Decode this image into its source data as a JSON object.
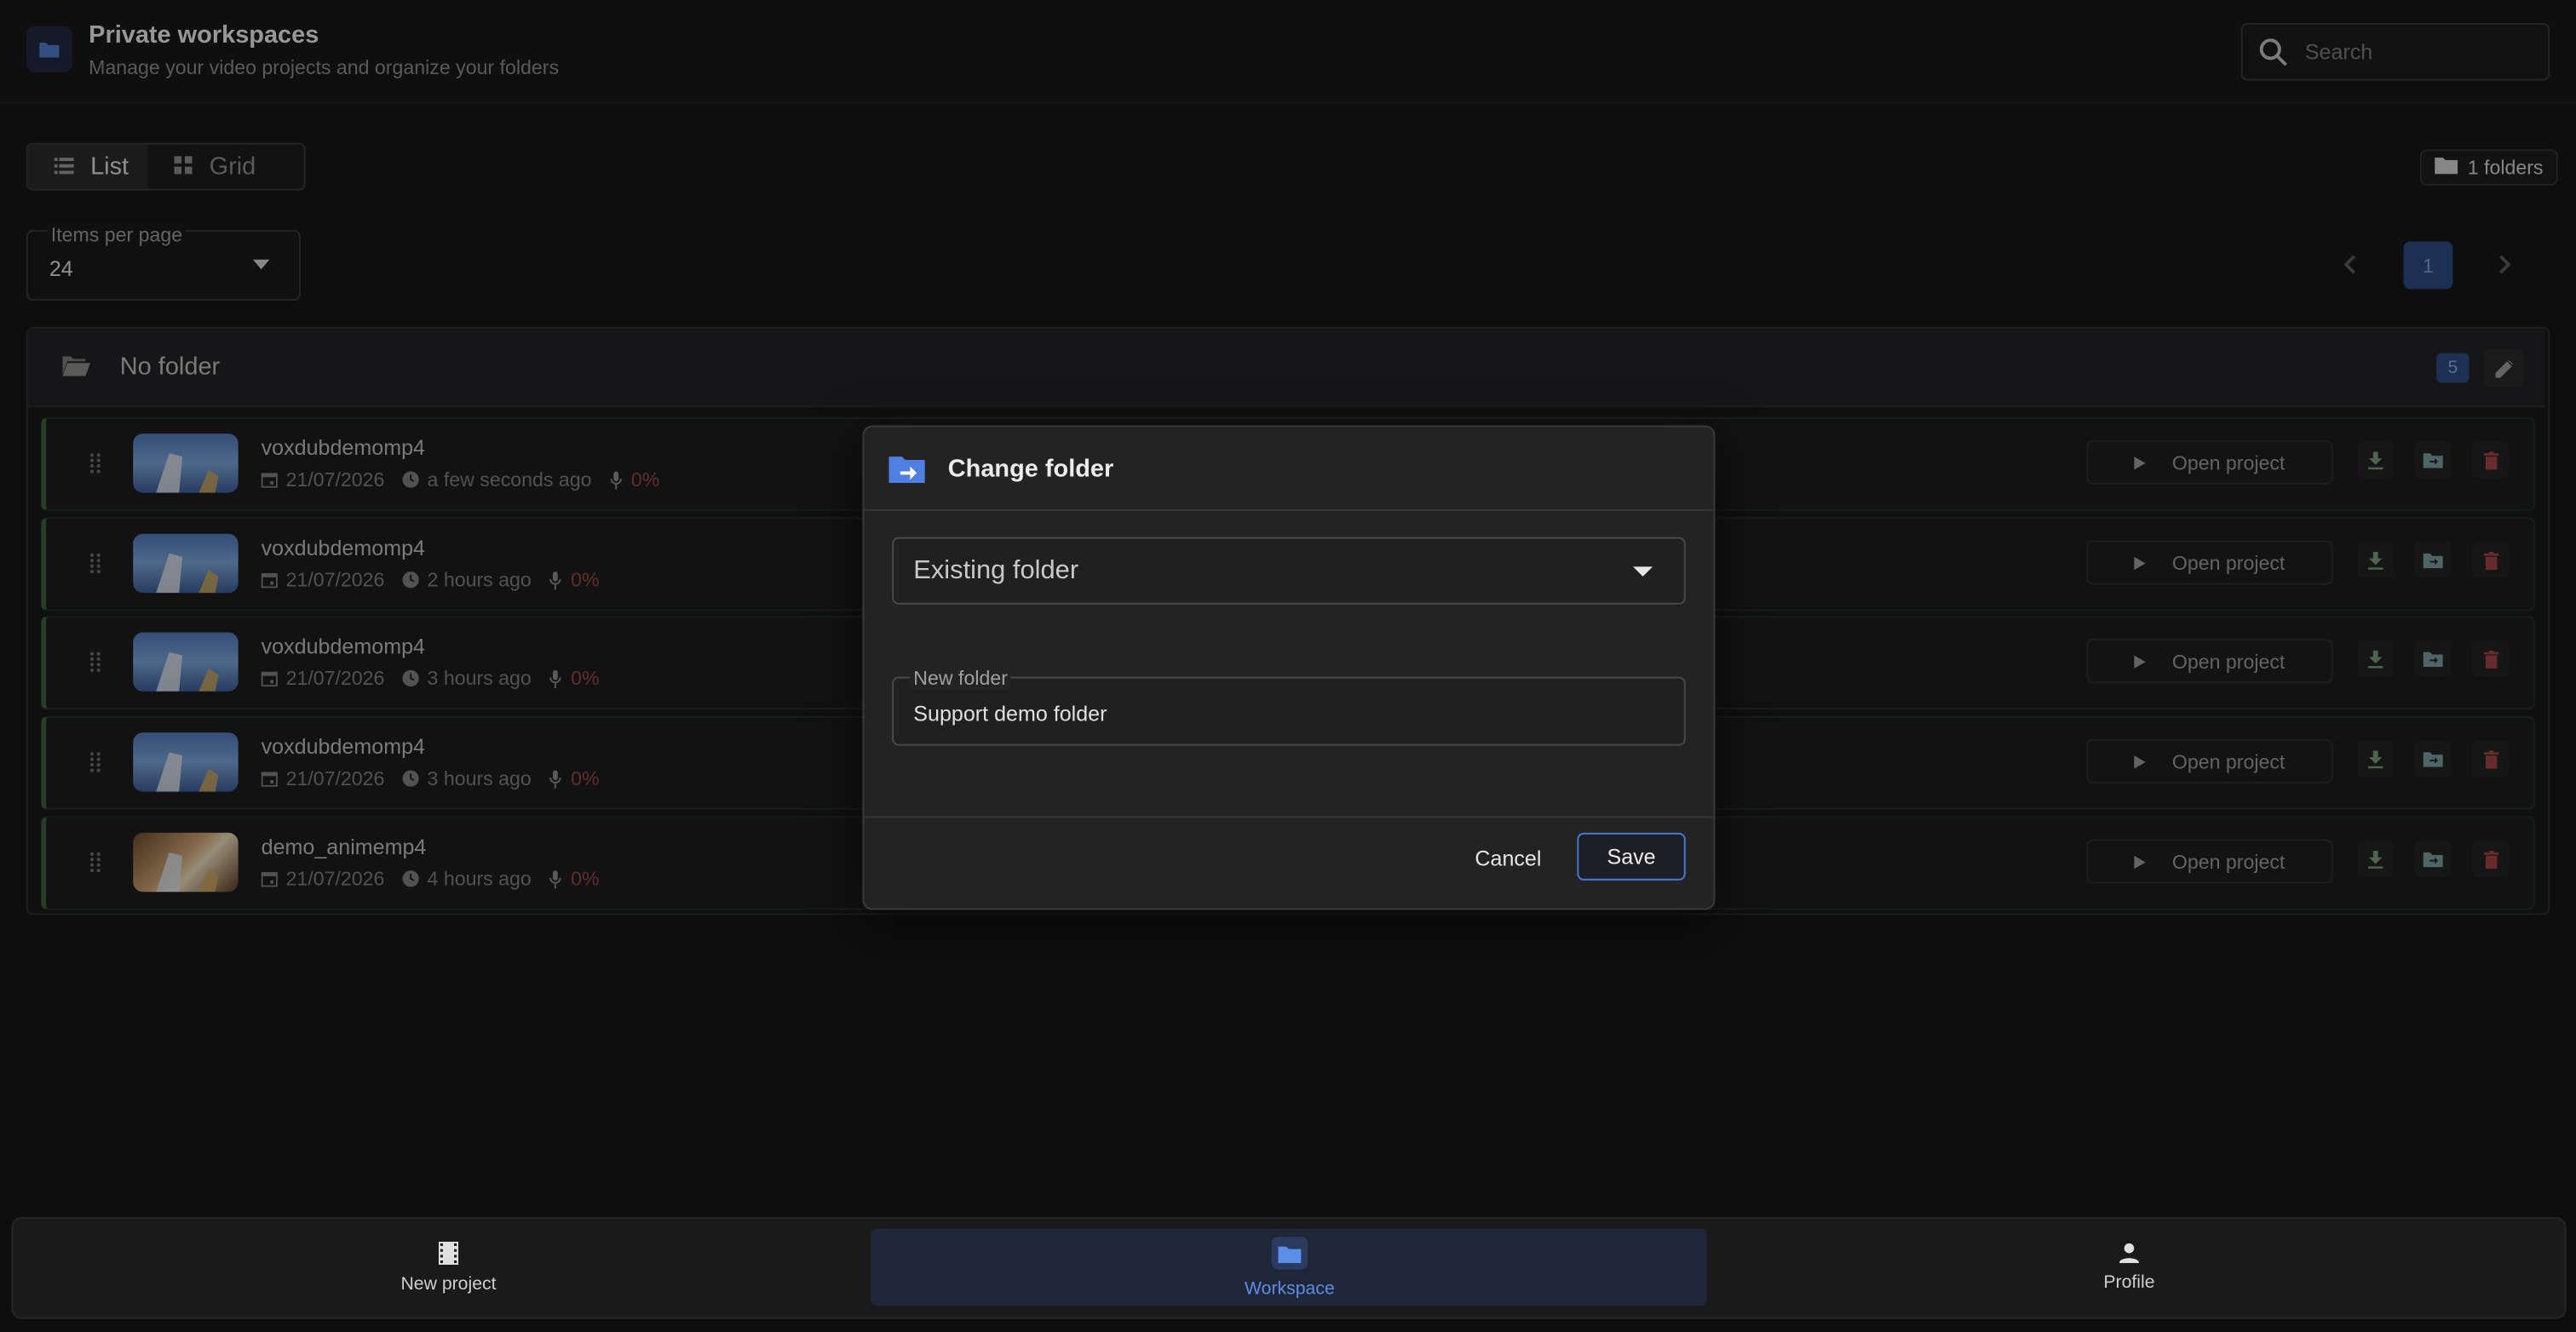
{
  "header": {
    "title": "Private workspaces",
    "subtitle": "Manage your video projects and organize your folders",
    "search_placeholder": "Search"
  },
  "view_toggle": {
    "list_label": "List",
    "grid_label": "Grid",
    "active": "List"
  },
  "folders_badge": "1 folders",
  "items_per_page": {
    "label": "Items per page",
    "value": "24"
  },
  "pagination": {
    "current_page": "1"
  },
  "folder_group": {
    "title": "No folder",
    "count": "5"
  },
  "projects": [
    {
      "name": "voxdubdemomp4",
      "date": "21/07/2026",
      "time": "a few seconds ago",
      "progress": "0%",
      "open_label": "Open project",
      "thumb": "blue"
    },
    {
      "name": "voxdubdemomp4",
      "date": "21/07/2026",
      "time": "2 hours ago",
      "progress": "0%",
      "open_label": "Open project",
      "thumb": "blue"
    },
    {
      "name": "voxdubdemomp4",
      "date": "21/07/2026",
      "time": "3 hours ago",
      "progress": "0%",
      "open_label": "Open project",
      "thumb": "blue"
    },
    {
      "name": "voxdubdemomp4",
      "date": "21/07/2026",
      "time": "3 hours ago",
      "progress": "0%",
      "open_label": "Open project",
      "thumb": "blue"
    },
    {
      "name": "demo_animemp4",
      "date": "21/07/2026",
      "time": "4 hours ago",
      "progress": "0%",
      "open_label": "Open project",
      "thumb": "brown"
    }
  ],
  "dialog": {
    "title": "Change folder",
    "select_value": "Existing folder",
    "new_folder_label": "New folder",
    "new_folder_value": "Support demo folder",
    "cancel_label": "Cancel",
    "save_label": "Save"
  },
  "bottom_nav": {
    "items": [
      {
        "label": "New project",
        "icon": "film-icon"
      },
      {
        "label": "Workspace",
        "icon": "folder-icon"
      },
      {
        "label": "Profile",
        "icon": "person-icon"
      }
    ],
    "active": "Workspace"
  },
  "colors": {
    "accent": "#4a7ad8",
    "active_nav_text": "#5b8ee6",
    "progress_text": "#9a4545",
    "row_border": "#3d5e3d"
  }
}
